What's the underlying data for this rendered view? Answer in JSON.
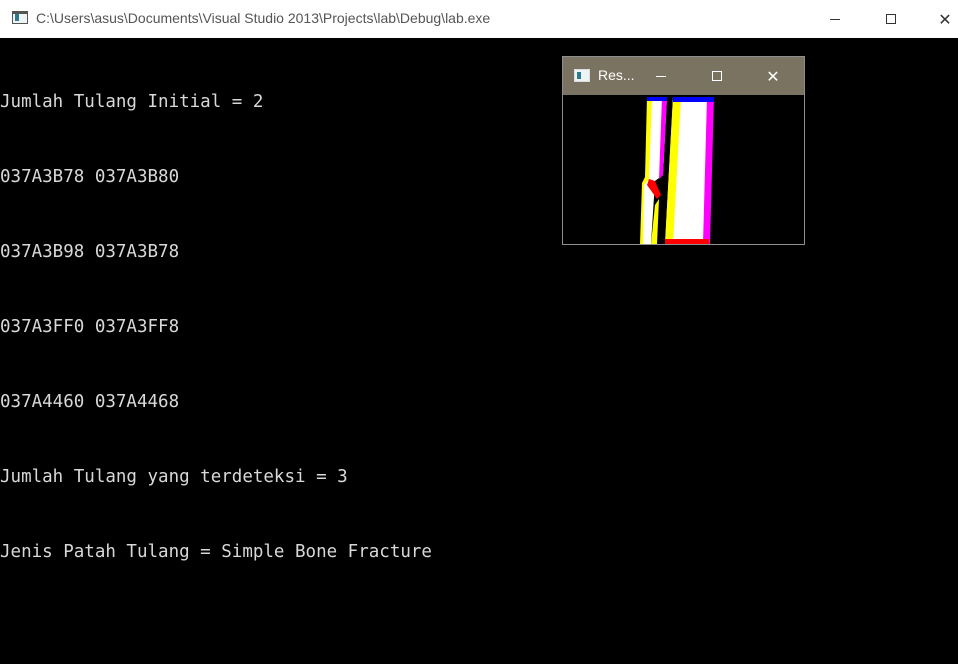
{
  "window": {
    "title": "C:\\Users\\asus\\Documents\\Visual Studio 2013\\Projects\\lab\\Debug\\lab.exe",
    "close_glyph": "✕"
  },
  "console": {
    "lines": [
      "Jumlah Tulang Initial = 2",
      "037A3B78 037A3B80",
      "037A3B98 037A3B78",
      "037A3FF0 037A3FF8",
      "037A4460 037A4468",
      "Jumlah Tulang yang terdeteksi = 3",
      "Jenis Patah Tulang = Simple Bone Fracture"
    ]
  },
  "result_window": {
    "title": "Res...",
    "close_glyph": "✕"
  },
  "colors": {
    "console_bg": "#000000",
    "console_text": "#d8d8d8",
    "result_titlebar": "#7b7361"
  }
}
